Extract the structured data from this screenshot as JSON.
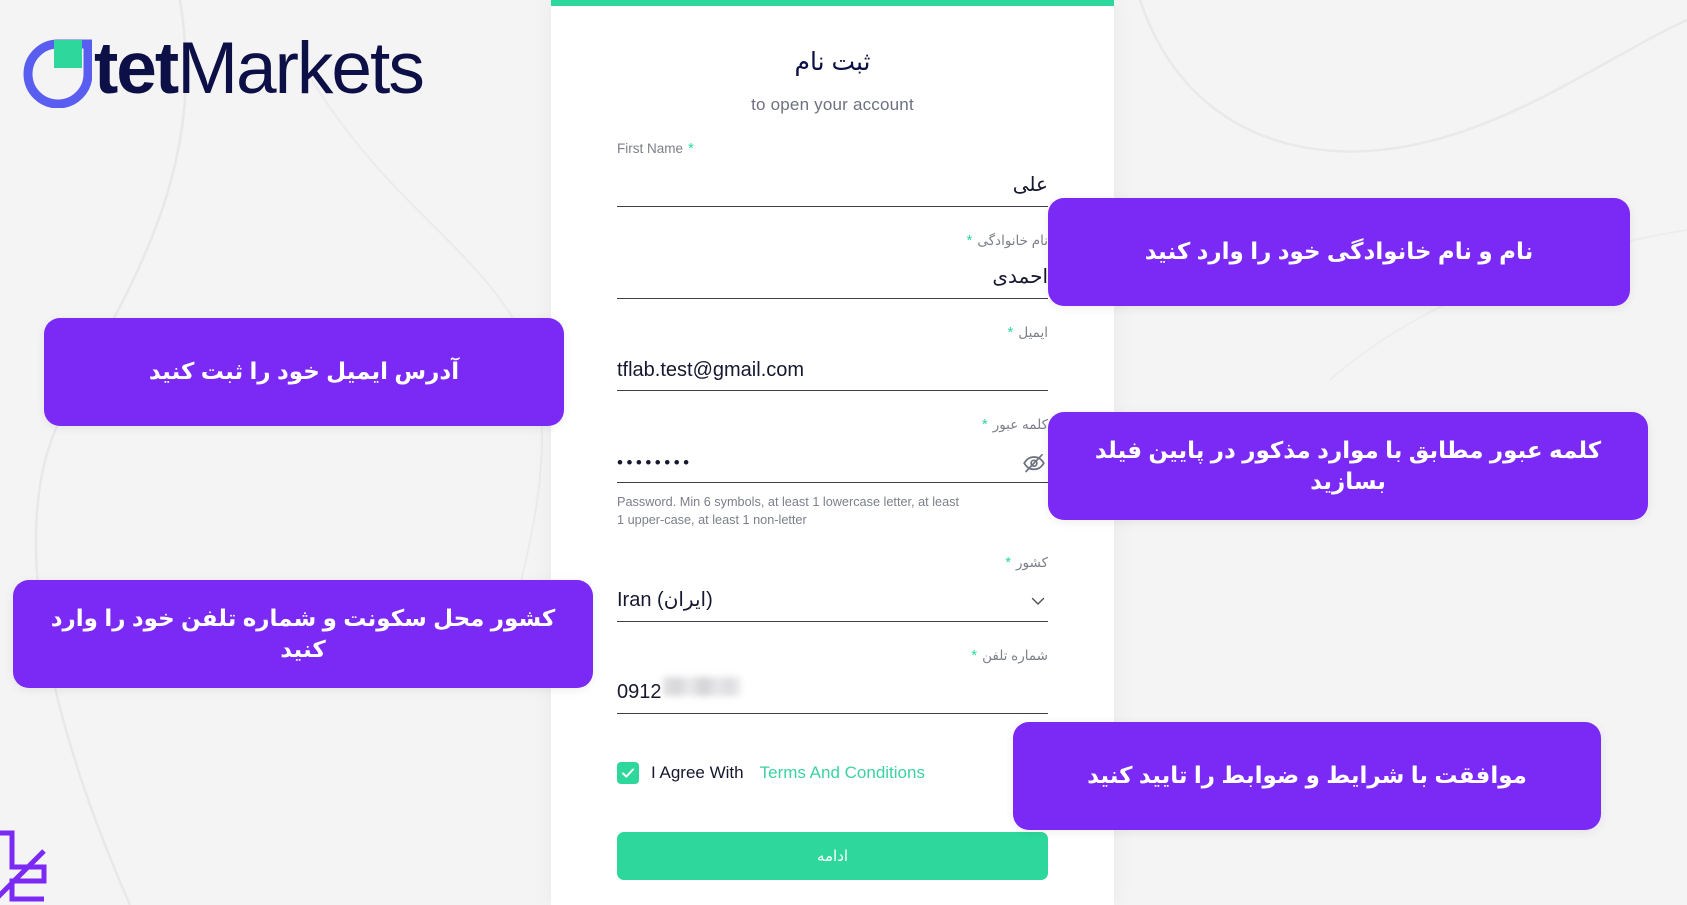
{
  "brand": {
    "name_bold": "tet",
    "name_light": "Markets",
    "mark_icon": "otet-circle-logo-icon",
    "colors": {
      "blue": "#5a5ef0",
      "green": "#2ed79c",
      "navy": "#0d1046"
    }
  },
  "form": {
    "title": "ثبت نام",
    "subtitle": "to open your account",
    "accent_green": "#2ed79c",
    "fields": [
      {
        "key": "first_name",
        "label": "First Name",
        "required_mark": "*",
        "value": "علی",
        "dir": "rtl",
        "type": "text"
      },
      {
        "key": "last_name",
        "label": "نام خانوادگی",
        "required_mark": "*",
        "value": "احمدی",
        "dir": "rtl",
        "type": "text"
      },
      {
        "key": "email",
        "label": "ایمیل",
        "required_mark": "*",
        "value": "tflab.test@gmail.com",
        "dir": "ltr",
        "type": "email"
      },
      {
        "key": "password",
        "label": "کلمه عبور",
        "required_mark": "*",
        "value": "••••••••",
        "dir": "ltr",
        "type": "password",
        "toggle_icon": "eye-off-icon",
        "hint": "Password. Min 6 symbols, at least 1 lowercase letter, at least 1 upper-case, at least 1 non-letter"
      },
      {
        "key": "country",
        "label": "کشور",
        "required_mark": "*",
        "value": "Iran (ایران)",
        "dir": "ltr",
        "type": "select",
        "chevron_icon": "chevron-down-icon"
      },
      {
        "key": "phone",
        "label": "شماره تلفن",
        "required_mark": "*",
        "value": "0912",
        "dir": "ltr",
        "type": "tel",
        "redacted": true
      }
    ],
    "terms": {
      "checked": true,
      "check_icon": "check-icon",
      "text": "I Agree With",
      "link_text": "Terms And Conditions",
      "link_color": "#3cd2a0"
    },
    "submit_label": "ادامه"
  },
  "callouts": {
    "color": "#7b29f5",
    "name": "نام و نام خانوادگی خود را وارد کنید",
    "email": "آدرس ایمیل خود را ثبت کنید",
    "password": "کلمه عبور مطابق با موارد مذکور در پایین فیلد بسازید",
    "country": "کشور محل سکونت و شماره تلفن خود را وارد کنید",
    "terms": "موافقت با شرایط و ضوابط را تایید کنید"
  },
  "watermark": {
    "icon": "brand-watermark-icon",
    "color": "#7b29f5"
  }
}
